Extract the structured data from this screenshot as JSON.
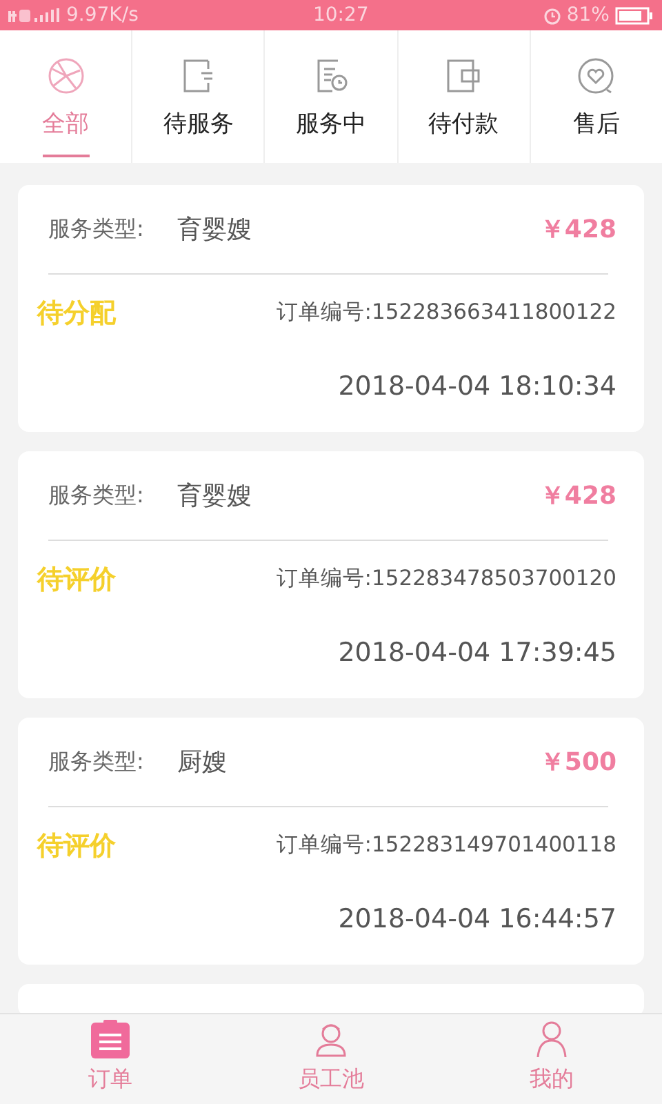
{
  "status_bar": {
    "speed": "9.97K/s",
    "time": "10:27",
    "battery": "81%"
  },
  "tabs": [
    {
      "label": "全部",
      "selected": true
    },
    {
      "label": "待服务",
      "selected": false
    },
    {
      "label": "服务中",
      "selected": false
    },
    {
      "label": "待付款",
      "selected": false
    },
    {
      "label": "售后",
      "selected": false
    }
  ],
  "orders": [
    {
      "type_label": "服务类型:",
      "type": "育婴嫂",
      "price": "￥428",
      "status": "待分配",
      "order_no": "订单编号:152283663411800122",
      "time": "2018-04-04 18:10:34"
    },
    {
      "type_label": "服务类型:",
      "type": "育婴嫂",
      "price": "￥428",
      "status": "待评价",
      "order_no": "订单编号:152283478503700120",
      "time": "2018-04-04 17:39:45"
    },
    {
      "type_label": "服务类型:",
      "type": "厨嫂",
      "price": "￥500",
      "status": "待评价",
      "order_no": "订单编号:152283149701400118",
      "time": "2018-04-04 16:44:57"
    }
  ],
  "bottom_nav": [
    {
      "label": "订单",
      "selected": true
    },
    {
      "label": "员工池",
      "selected": false
    },
    {
      "label": "我的",
      "selected": false
    }
  ]
}
